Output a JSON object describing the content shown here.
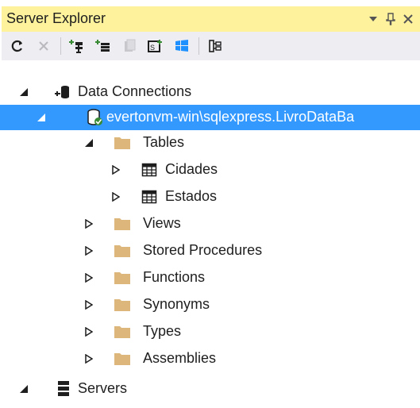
{
  "window": {
    "title": "Server Explorer",
    "title_bg": "#fff29d"
  },
  "toolbar": {
    "buttons": [
      "refresh-icon",
      "stop-icon",
      "connect-to-database-icon",
      "connect-to-server-icon",
      "connect-to-sharepoint-icon",
      "connect-to-azure-icon",
      "windows-icon",
      "properties-icon"
    ]
  },
  "tree": {
    "data_connections": "Data Connections",
    "connection": "evertonvm-win\\sqlexpress.LivroDataBa",
    "tables": "Tables",
    "cidades": "Cidades",
    "estados": "Estados",
    "views": "Views",
    "stored_procedures": "Stored Procedures",
    "functions": "Functions",
    "synonyms": "Synonyms",
    "types": "Types",
    "assemblies": "Assemblies",
    "servers": "Servers"
  },
  "colors": {
    "selection": "#3399ff",
    "folder": "#dcb67a"
  }
}
